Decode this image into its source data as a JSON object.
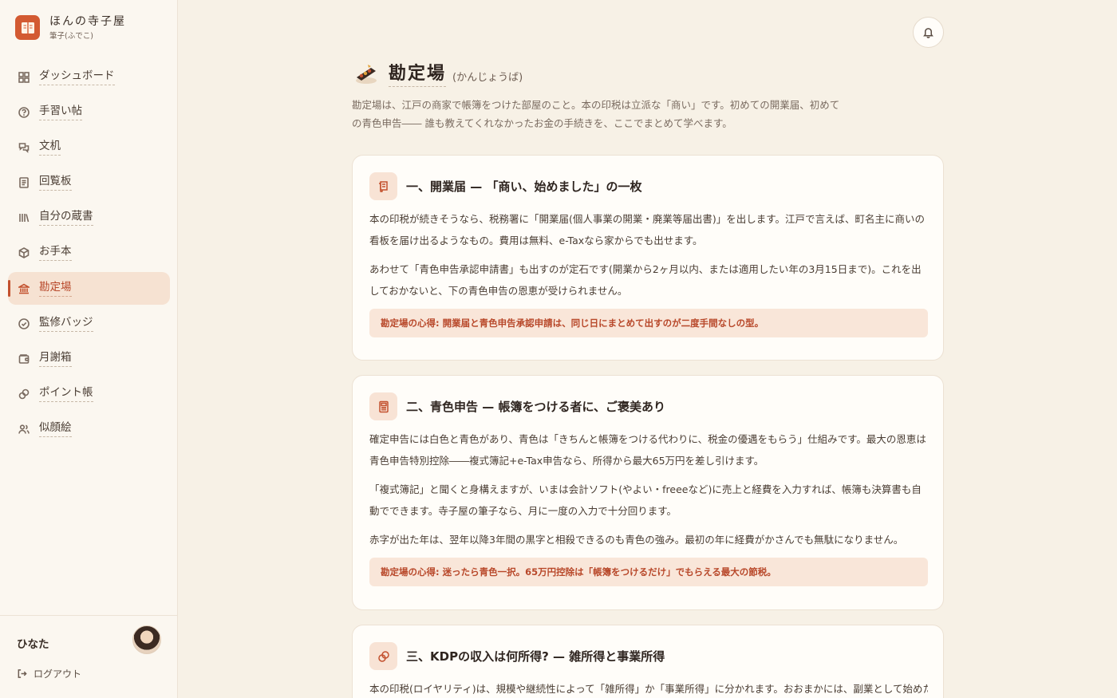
{
  "brand": {
    "name": "ほんの寺子屋",
    "sub": "筆子(ふでこ)"
  },
  "nav": {
    "items": [
      {
        "label": "ダッシュボード",
        "icon": "dashboard-icon"
      },
      {
        "label": "手習い帖",
        "icon": "help-circle-icon"
      },
      {
        "label": "文机",
        "icon": "chat-icon"
      },
      {
        "label": "回覧板",
        "icon": "document-icon"
      },
      {
        "label": "自分の蔵書",
        "icon": "library-icon"
      },
      {
        "label": "お手本",
        "icon": "box-icon"
      },
      {
        "label": "勘定場",
        "icon": "bank-icon",
        "active": true
      },
      {
        "label": "監修バッジ",
        "icon": "check-circle-icon"
      },
      {
        "label": "月謝箱",
        "icon": "wallet-icon"
      },
      {
        "label": "ポイント帳",
        "icon": "coins-icon"
      },
      {
        "label": "似顔絵",
        "icon": "users-icon"
      }
    ]
  },
  "user": {
    "name": "ひなた",
    "logout_label": "ログアウト"
  },
  "header": {
    "title": "勘定場",
    "reading": "(かんじょうば)",
    "description": "勘定場は、江戸の商家で帳簿をつけた部屋のこと。本の印税は立派な「商い」です。初めての開業届、初めての青色申告―― 誰も教えてくれなかったお金の手続きを、ここでまとめて学べます。"
  },
  "cards": [
    {
      "title": "一、開業届 — 「商い、始めました」の一枚",
      "icon": "scroll-icon",
      "paragraphs": [
        "本の印税が続きそうなら、税務署に「開業届(個人事業の開業・廃業等届出書)」を出します。江戸で言えば、町名主に商いの看板を届け出るようなもの。費用は無料、e-Taxなら家からでも出せます。",
        "あわせて「青色申告承認申請書」も出すのが定石です(開業から2ヶ月以内、または適用したい年の3月15日まで)。これを出しておかないと、下の青色申告の恩恵が受けられません。"
      ],
      "tip": "勘定場の心得: 開業届と青色申告承認申請は、同じ日にまとめて出すのが二度手間なしの型。"
    },
    {
      "title": "二、青色申告 — 帳簿をつける者に、ご褒美あり",
      "icon": "calculator-icon",
      "paragraphs": [
        "確定申告には白色と青色があり、青色は「きちんと帳簿をつける代わりに、税金の優遇をもらう」仕組みです。最大の恩恵は青色申告特別控除――複式簿記+e-Tax申告なら、所得から最大65万円を差し引けます。",
        "「複式簿記」と聞くと身構えますが、いまは会計ソフト(やよい・freeeなど)に売上と経費を入力すれば、帳簿も決算書も自動でできます。寺子屋の筆子なら、月に一度の入力で十分回ります。",
        "赤字が出た年は、翌年以降3年間の黒字と相殺できるのも青色の強み。最初の年に経費がかさんでも無駄になりません。"
      ],
      "tip": "勘定場の心得: 迷ったら青色一択。65万円控除は「帳簿をつけるだけ」でもらえる最大の節税。"
    },
    {
      "title": "三、KDPの収入は何所得? — 雑所得と事業所得",
      "icon": "coins-icon",
      "paragraphs": [
        "本の印税(ロイヤリティ)は、規模や継続性によって「雑所得」か「事業所得」に分かれます。おおまかには、副業として始めたば"
      ]
    }
  ]
}
